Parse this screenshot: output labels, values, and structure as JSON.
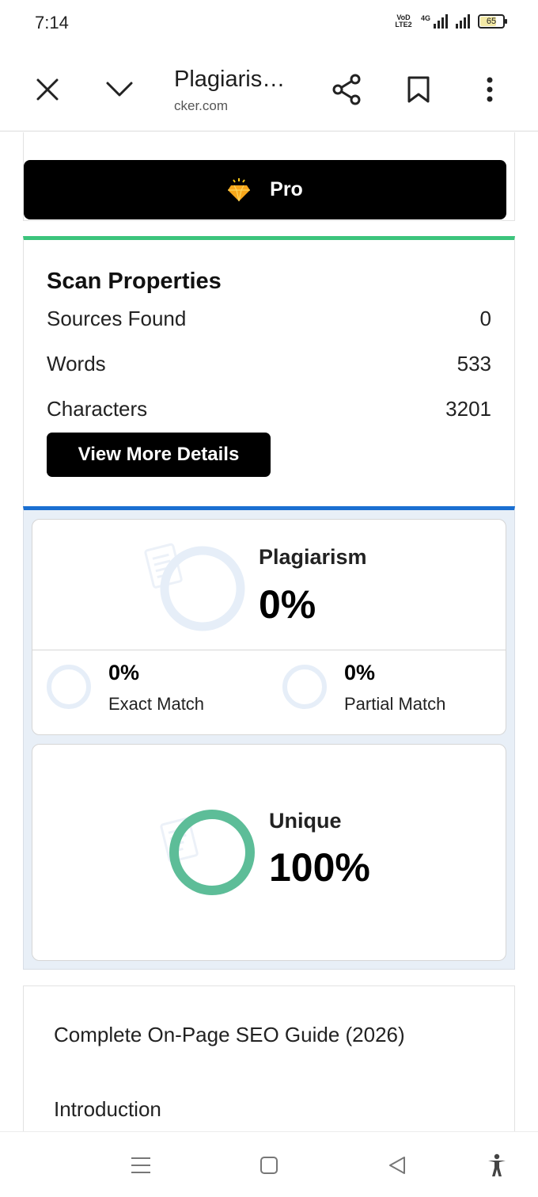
{
  "status_bar": {
    "time": "7:14",
    "volte_label": "VoD LTE2",
    "network_tag": "4G",
    "battery_level": "65"
  },
  "toolbar": {
    "title": "Plagiaris…",
    "url": "cker.com"
  },
  "pro": {
    "label": "Pro"
  },
  "scan": {
    "title": "Scan Properties",
    "rows": [
      {
        "label": "Sources Found",
        "value": "0"
      },
      {
        "label": "Words",
        "value": "533"
      },
      {
        "label": "Characters",
        "value": "3201"
      }
    ],
    "details_label": "View More Details"
  },
  "results": {
    "plagiarism_label": "Plagiarism",
    "plagiarism_value": "0%",
    "exact_value": "0%",
    "exact_label": "Exact Match",
    "partial_value": "0%",
    "partial_label": "Partial Match",
    "unique_label": "Unique",
    "unique_value": "100%",
    "colors": {
      "unique_ring": "#5dbd98",
      "empty_ring": "#e6eef8",
      "scan_accent": "#3cc47c",
      "results_accent": "#1a6fd1"
    }
  },
  "article": {
    "title": "Complete On-Page SEO Guide (2026)",
    "intro": "Introduction"
  }
}
